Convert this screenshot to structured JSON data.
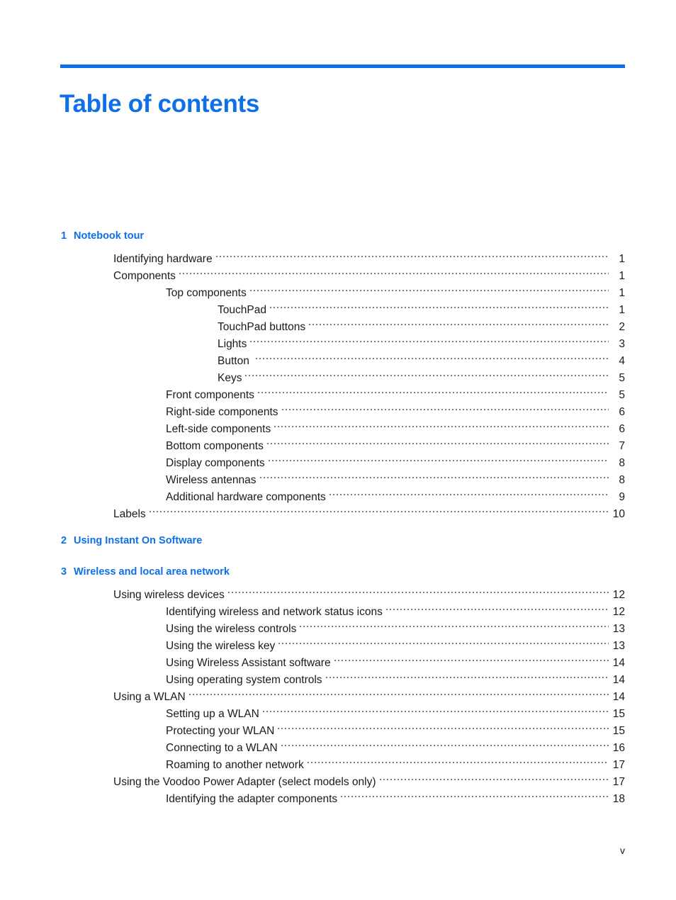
{
  "document": {
    "title": "Table of contents",
    "folio": "v",
    "accent_color": "#0F6FE8",
    "text_color": "#1a1a1a"
  },
  "toc": {
    "chapters": [
      {
        "number": "1",
        "title": "Notebook tour",
        "entries": [
          {
            "level": 1,
            "label": "Identifying hardware",
            "page": "1"
          },
          {
            "level": 1,
            "label": "Components",
            "page": "1"
          },
          {
            "level": 2,
            "label": "Top components",
            "page": "1"
          },
          {
            "level": 3,
            "label": "TouchPad",
            "page": "1"
          },
          {
            "level": 3,
            "label": "TouchPad buttons",
            "page": "2"
          },
          {
            "level": 3,
            "label": "Lights",
            "page": "3"
          },
          {
            "level": 3,
            "label": "Button ",
            "page": "4"
          },
          {
            "level": 3,
            "label": "Keys",
            "page": "5"
          },
          {
            "level": 2,
            "label": "Front components",
            "page": "5"
          },
          {
            "level": 2,
            "label": "Right-side components",
            "page": "6"
          },
          {
            "level": 2,
            "label": "Left-side components",
            "page": "6"
          },
          {
            "level": 2,
            "label": "Bottom components",
            "page": "7"
          },
          {
            "level": 2,
            "label": "Display components",
            "page": "8"
          },
          {
            "level": 2,
            "label": "Wireless antennas",
            "page": "8"
          },
          {
            "level": 2,
            "label": "Additional hardware components",
            "page": "9"
          },
          {
            "level": 1,
            "label": "Labels",
            "page": "10"
          }
        ]
      },
      {
        "number": "2",
        "title": "Using Instant On Software",
        "entries": []
      },
      {
        "number": "3",
        "title": "Wireless and local area network",
        "entries": [
          {
            "level": 1,
            "label": "Using wireless devices",
            "page": "12"
          },
          {
            "level": 2,
            "label": "Identifying wireless and network status icons",
            "page": "12"
          },
          {
            "level": 2,
            "label": "Using the wireless controls",
            "page": "13"
          },
          {
            "level": 2,
            "label": "Using the wireless key",
            "page": "13"
          },
          {
            "level": 2,
            "label": "Using Wireless Assistant software",
            "page": "14"
          },
          {
            "level": 2,
            "label": "Using operating system controls",
            "page": "14"
          },
          {
            "level": 1,
            "label": "Using a WLAN",
            "page": "14"
          },
          {
            "level": 2,
            "label": "Setting up a WLAN",
            "page": "15"
          },
          {
            "level": 2,
            "label": "Protecting your WLAN",
            "page": "15"
          },
          {
            "level": 2,
            "label": "Connecting to a WLAN",
            "page": "16"
          },
          {
            "level": 2,
            "label": "Roaming to another network",
            "page": "17"
          },
          {
            "level": 1,
            "label": "Using the Voodoo Power Adapter (select models only)",
            "page": "17"
          },
          {
            "level": 2,
            "label": "Identifying the adapter components",
            "page": "18"
          }
        ]
      }
    ]
  }
}
